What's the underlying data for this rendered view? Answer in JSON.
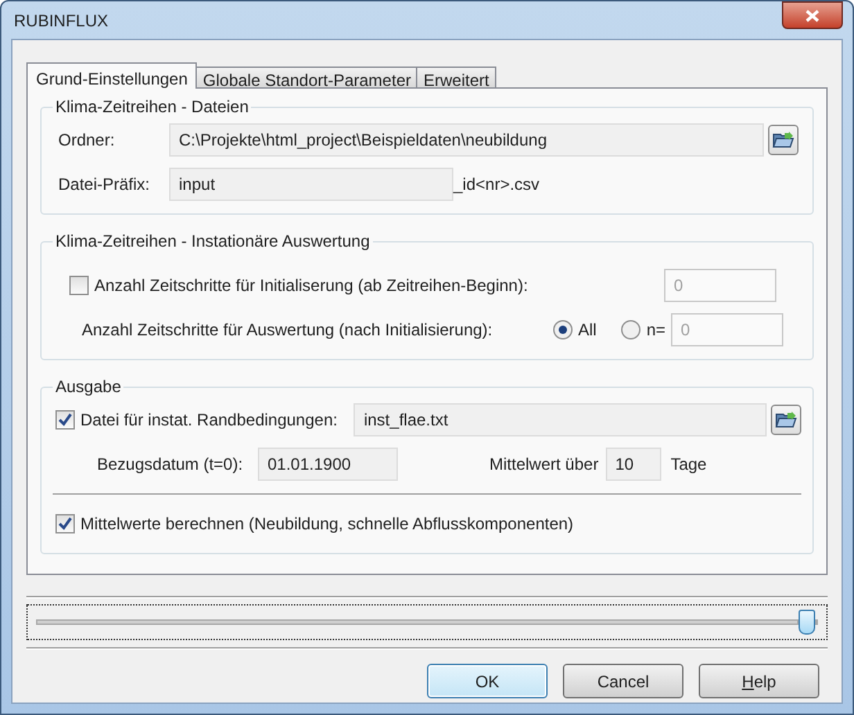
{
  "window": {
    "title": "RUBINFLUX"
  },
  "tabs": [
    {
      "label": "Grund-Einstellungen",
      "selected": true
    },
    {
      "label": "Globale Standort-Parameter",
      "selected": false
    },
    {
      "label": "Erweitert",
      "selected": false
    }
  ],
  "files_group": {
    "title": "Klima-Zeitreihen - Dateien",
    "folder_label": "Ordner:",
    "folder_value": "C:\\Projekte\\html_project\\Beispieldaten\\neubildung",
    "prefix_label": "Datei-Präfix:",
    "prefix_value": "input",
    "prefix_suffix": "_id<nr>.csv"
  },
  "evaluation_group": {
    "title": "Klima-Zeitreihen - Instationäre Auswertung",
    "init_checkbox": {
      "label": "Anzahl Zeitschritte für Initialiserung (ab Zeitreihen-Beginn):",
      "checked": false
    },
    "init_value": "0",
    "init_disabled": true,
    "eval_label": "Anzahl Zeitschritte für Auswertung (nach Initialisierung):",
    "radios": [
      {
        "label": "All",
        "selected": true
      },
      {
        "label": "n=",
        "selected": false
      }
    ],
    "n_value": "0",
    "n_disabled": true
  },
  "output_group": {
    "title": "Ausgabe",
    "file_checkbox": {
      "label": "Datei für instat. Randbedingungen:",
      "checked": true
    },
    "file_value": "inst_flae.txt",
    "date_label": "Bezugsdatum (t=0):",
    "date_value": "01.01.1900",
    "mean_label": "Mittelwert über",
    "mean_value": "10",
    "mean_unit": "Tage",
    "mean_checkbox": {
      "label": "Mittelwerte berechnen (Neubildung, schnelle Abflusskomponenten)",
      "checked": true
    }
  },
  "slider": {
    "level": 1
  },
  "buttons": [
    {
      "label": "OK",
      "default": true,
      "underline_first": false
    },
    {
      "label": "Cancel",
      "default": false,
      "underline_first": false
    },
    {
      "label": "Help",
      "default": false,
      "underline_first": true
    }
  ]
}
